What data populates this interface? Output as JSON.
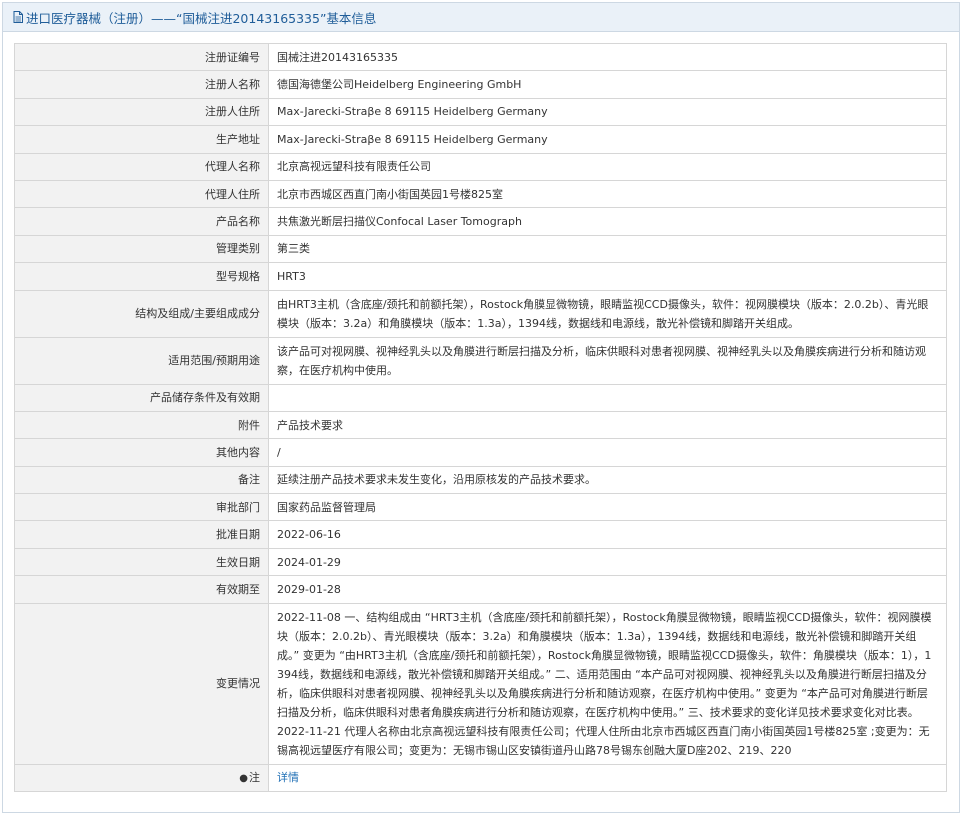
{
  "header": {
    "title": "进口医疗器械（注册）——“国械注进20143165335”基本信息"
  },
  "rows": [
    {
      "label": "注册证编号",
      "value": "国械注进20143165335"
    },
    {
      "label": "注册人名称",
      "value": "德国海德堡公司Heidelberg Engineering GmbH"
    },
    {
      "label": "注册人住所",
      "value": "Max-Jarecki-Straβe 8 69115 Heidelberg Germany"
    },
    {
      "label": "生产地址",
      "value": "Max-Jarecki-Straβe 8 69115 Heidelberg Germany"
    },
    {
      "label": "代理人名称",
      "value": "北京高视远望科技有限责任公司"
    },
    {
      "label": "代理人住所",
      "value": "北京市西城区西直门南小街国英园1号楼825室"
    },
    {
      "label": "产品名称",
      "value": "共焦激光断层扫描仪Confocal Laser Tomograph"
    },
    {
      "label": "管理类别",
      "value": "第三类"
    },
    {
      "label": "型号规格",
      "value": "HRT3"
    },
    {
      "label": "结构及组成/主要组成成分",
      "value": "由HRT3主机（含底座/颈托和前额托架），Rostock角膜显微物镜，眼睛监视CCD摄像头，软件：视网膜模块（版本：2.0.2b）、青光眼模块（版本：3.2a）和角膜模块（版本：1.3a），1394线，数据线和电源线，散光补偿镜和脚踏开关组成。"
    },
    {
      "label": "适用范围/预期用途",
      "value": "该产品可对视网膜、视神经乳头以及角膜进行断层扫描及分析，临床供眼科对患者视网膜、视神经乳头以及角膜疾病进行分析和随访观察，在医疗机构中使用。"
    },
    {
      "label": "产品储存条件及有效期",
      "value": ""
    },
    {
      "label": "附件",
      "value": "产品技术要求"
    },
    {
      "label": "其他内容",
      "value": "/"
    },
    {
      "label": "备注",
      "value": "延续注册产品技术要求未发生变化，沿用原核发的产品技术要求。"
    },
    {
      "label": "审批部门",
      "value": "国家药品监督管理局"
    },
    {
      "label": "批准日期",
      "value": "2022-06-16"
    },
    {
      "label": "生效日期",
      "value": "2024-01-29"
    },
    {
      "label": "有效期至",
      "value": "2029-01-28"
    }
  ],
  "changes": {
    "label": "变更情况",
    "entries": [
      "2022-11-08 一、结构组成由 “HRT3主机（含底座/颈托和前额托架），Rostock角膜显微物镜，眼睛监视CCD摄像头，软件：视网膜模块（版本：2.0.2b）、青光眼模块（版本：3.2a）和角膜模块（版本：1.3a），1394线，数据线和电源线，散光补偿镜和脚踏开关组成。” 变更为 “由HRT3主机（含底座/颈托和前额托架），Rostock角膜显微物镜，眼睛监视CCD摄像头，软件：角膜模块（版本：1），1394线，数据线和电源线，散光补偿镜和脚踏开关组成。” 二、适用范围由 “本产品可对视网膜、视神经乳头以及角膜进行断层扫描及分析，临床供眼科对患者视网膜、视神经乳头以及角膜疾病进行分析和随访观察，在医疗机构中使用。” 变更为 “本产品可对角膜进行断层扫描及分析，临床供眼科对患者角膜疾病进行分析和随访观察，在医疗机构中使用。” 三、技术要求的变化详见技术要求变化对比表。",
      "2022-11-21 代理人名称由北京高视远望科技有限责任公司；代理人住所由北京市西城区西直门南小街国英园1号楼825室 ;变更为：无锡高视远望医疗有限公司；变更为：无锡市锡山区安镇街道丹山路78号锡东创融大厦D座202、219、220"
    ]
  },
  "note": {
    "pin_glyph": "●",
    "label": "注",
    "link_text": "详情"
  },
  "colors": {
    "header_bg": "#eaf1f8",
    "header_text": "#1f5d99",
    "label_bg": "#f2f2f2",
    "link": "#1f6fb5"
  }
}
